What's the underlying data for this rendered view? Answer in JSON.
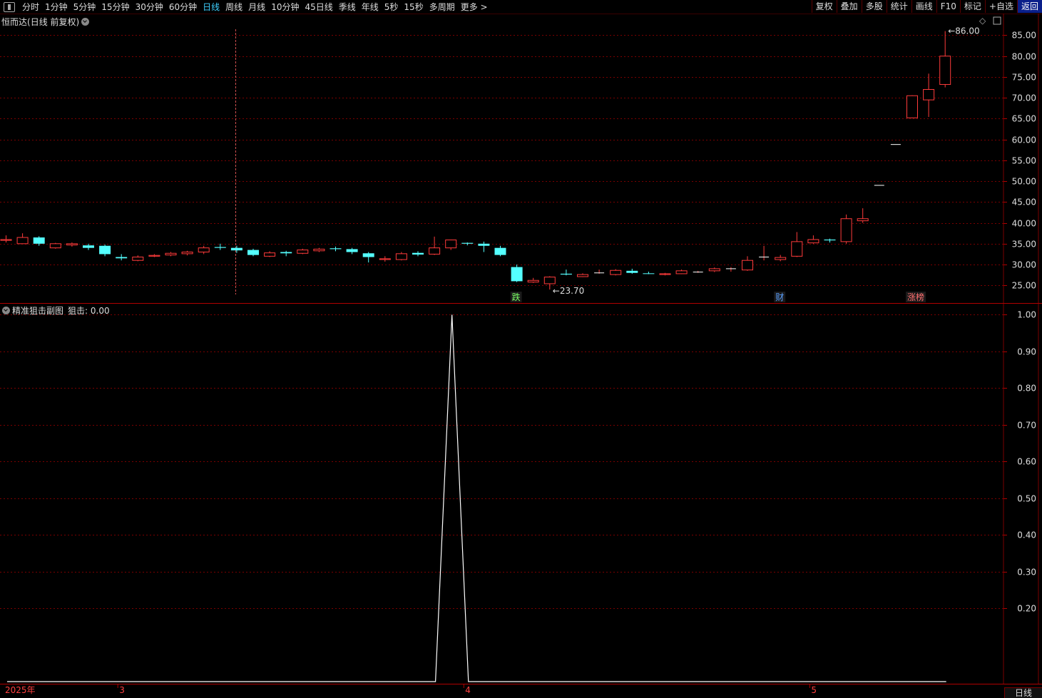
{
  "toolbar": {
    "periods": [
      "分时",
      "1分钟",
      "5分钟",
      "15分钟",
      "30分钟",
      "60分钟",
      "日线",
      "周线",
      "月线",
      "10分钟",
      "45日线",
      "季线",
      "年线",
      "5秒",
      "15秒",
      "多周期",
      "更多 >"
    ],
    "active": "日线",
    "tools": [
      "复权",
      "叠加",
      "多股",
      "统计",
      "画线",
      "F10",
      "标记",
      "+自选",
      "返回"
    ]
  },
  "main_title": {
    "name": "恒而达",
    "mode": "(日线 前复权)"
  },
  "sub_title": {
    "name": "精准狙击副图",
    "value": "狙击: 0.00"
  },
  "corner_label": "日线",
  "colors": {
    "up": "#ff3b3b",
    "down": "#54ffff",
    "grid": "#7a0000",
    "line": "#ffffff"
  },
  "chart_data": [
    {
      "type": "candlestick",
      "title": "恒而达(日线 前复权)",
      "ylim": [
        21.8,
        88.5
      ],
      "yticks": [
        25,
        30,
        35,
        40,
        45,
        50,
        55,
        60,
        65,
        70,
        75,
        80,
        85
      ],
      "y_tick_labels": [
        "25.00",
        "30.00",
        "35.00",
        "40.00",
        "45.00",
        "50.00",
        "55.00",
        "60.00",
        "65.00",
        "70.00",
        "75.00",
        "80.00",
        "85.00"
      ],
      "candles": [
        [
          35.8,
          36.0,
          37.0,
          35.3
        ],
        [
          35.0,
          36.5,
          37.5,
          35.0
        ],
        [
          36.5,
          35.0,
          36.8,
          34.5
        ],
        [
          34.0,
          35.0,
          35.2,
          33.8
        ],
        [
          34.7,
          35.0,
          35.3,
          34.3
        ],
        [
          34.6,
          34.0,
          35.0,
          33.5
        ],
        [
          34.5,
          32.5,
          34.8,
          32.0
        ],
        [
          31.8,
          31.5,
          32.5,
          31.0
        ],
        [
          31.0,
          31.8,
          32.2,
          30.8
        ],
        [
          32.0,
          32.2,
          32.5,
          31.8
        ],
        [
          32.3,
          32.7,
          33.0,
          32.0
        ],
        [
          32.6,
          33.0,
          33.3,
          32.2
        ],
        [
          33.0,
          34.0,
          34.5,
          32.5
        ],
        [
          34.2,
          34.0,
          35.0,
          33.5
        ],
        [
          34.0,
          33.4,
          34.5,
          32.8
        ],
        [
          33.5,
          32.3,
          33.8,
          32.0
        ],
        [
          32.0,
          32.8,
          33.2,
          31.8
        ],
        [
          33.0,
          32.7,
          33.3,
          32.0
        ],
        [
          32.7,
          33.5,
          33.8,
          32.5
        ],
        [
          33.3,
          33.7,
          34.0,
          33.0
        ],
        [
          33.9,
          33.7,
          34.3,
          33.2
        ],
        [
          33.7,
          33.0,
          34.0,
          32.5
        ],
        [
          32.7,
          31.8,
          33.0,
          30.5
        ],
        [
          31.2,
          31.4,
          32.0,
          30.7
        ],
        [
          31.2,
          32.6,
          33.0,
          31.0
        ],
        [
          32.8,
          32.4,
          33.2,
          32.0
        ],
        [
          32.5,
          34.0,
          36.7,
          32.3
        ],
        [
          34.0,
          35.9,
          36.0,
          33.5
        ],
        [
          35.2,
          35.0,
          35.3,
          34.6
        ],
        [
          35.0,
          34.5,
          35.5,
          33.0
        ],
        [
          34.0,
          32.3,
          34.5,
          32.0
        ],
        [
          29.4,
          26.0,
          30.0,
          25.8
        ],
        [
          25.8,
          26.2,
          26.8,
          25.6
        ],
        [
          25.4,
          27.0,
          27.2,
          24.0
        ],
        [
          27.8,
          27.6,
          28.8,
          27.4
        ],
        [
          27.1,
          27.6,
          27.9,
          27.0
        ],
        [
          28.0,
          28.0,
          28.8,
          27.8
        ],
        [
          27.6,
          28.6,
          28.9,
          27.4
        ],
        [
          28.5,
          28.0,
          29.0,
          27.8
        ],
        [
          27.9,
          27.8,
          28.3,
          27.7
        ],
        [
          27.6,
          27.8,
          28.0,
          27.4
        ],
        [
          27.8,
          28.5,
          28.8,
          27.7
        ],
        [
          28.2,
          28.2,
          28.5,
          28.0
        ],
        [
          28.5,
          29.0,
          29.3,
          28.2
        ],
        [
          29.0,
          29.0,
          29.4,
          28.3
        ],
        [
          28.7,
          31.0,
          32.0,
          28.5
        ],
        [
          31.8,
          31.8,
          34.5,
          31.0
        ],
        [
          31.2,
          31.7,
          32.3,
          30.8
        ],
        [
          32.0,
          35.5,
          37.8,
          31.8
        ],
        [
          35.2,
          36.0,
          37.0,
          35.0
        ],
        [
          36.0,
          35.8,
          36.2,
          35.3
        ],
        [
          35.5,
          41.0,
          42.0,
          35.0
        ],
        [
          40.5,
          41.0,
          43.5,
          40.0
        ],
        [
          49.0,
          49.0,
          49.0,
          49.0
        ],
        [
          58.8,
          58.8,
          58.8,
          58.8
        ],
        [
          65.2,
          70.5,
          70.6,
          65.2
        ],
        [
          69.5,
          72.0,
          75.8,
          65.4
        ],
        [
          73.2,
          80.0,
          86.0,
          72.5
        ]
      ],
      "annotations": [
        {
          "label": "86.00",
          "price": 86.0
        },
        {
          "label": "23.70",
          "price": 23.7
        }
      ],
      "markers": [
        {
          "label": "跌",
          "index": 31,
          "color": "#7cff66"
        },
        {
          "label": "财",
          "index": 47,
          "color": "#5aa0ff"
        },
        {
          "label": "涨榜",
          "index": 55,
          "color": "#ff7070"
        }
      ]
    },
    {
      "type": "line",
      "title": "精准狙击副图",
      "ylim": [
        0.0,
        1.03
      ],
      "yticks": [
        0.2,
        0.3,
        0.4,
        0.5,
        0.6,
        0.7,
        0.8,
        0.9,
        1.0
      ],
      "y_tick_labels": [
        "0.20",
        "0.30",
        "0.40",
        "0.50",
        "0.60",
        "0.70",
        "0.80",
        "0.90",
        "1.00"
      ],
      "series": [
        {
          "name": "狙击",
          "values": [
            0,
            0,
            0,
            0,
            0,
            0,
            0,
            0,
            0,
            0,
            0,
            0,
            0,
            0,
            0,
            0,
            0,
            0,
            0,
            0,
            0,
            0,
            0,
            0,
            0,
            0,
            0,
            1,
            0,
            0,
            0,
            0,
            0,
            0,
            0,
            0,
            0,
            0,
            0,
            0,
            0,
            0,
            0,
            0,
            0,
            0,
            0,
            0,
            0,
            0,
            0,
            0,
            0,
            0,
            0,
            0,
            0,
            0
          ]
        }
      ]
    }
  ],
  "x_axis_labels": [
    {
      "label": "2025年",
      "index": 0
    },
    {
      "label": "3",
      "index": 7
    },
    {
      "label": "4",
      "index": 28
    },
    {
      "label": "5",
      "index": 49
    }
  ]
}
